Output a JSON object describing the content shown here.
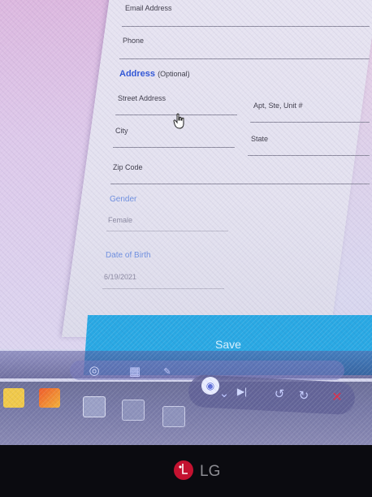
{
  "form": {
    "email_label": "Email Address",
    "phone_label": "Phone",
    "address_section": {
      "title": "Address",
      "optional_note": "(Optional)"
    },
    "street_label": "Street Address",
    "apt_label": "Apt, Ste, Unit #",
    "city_label": "City",
    "state_label": "State",
    "zip_label": "Zip Code",
    "gender_title": "Gender",
    "gender_value": "Female",
    "dob_title": "Date of Birth",
    "dob_value": "6/19/2021",
    "save_label": "Save"
  },
  "media_controls": {
    "icons": [
      "scan-icon",
      "grid-icon",
      "paint-icon",
      "camera-icon",
      "chevron-icon",
      "skip-next-icon",
      "undo-icon",
      "redo-icon",
      "close-icon"
    ]
  },
  "taskbar": {
    "icons": [
      "folder-icon",
      "pen-icon",
      "window-icon",
      "app-icon",
      "file-icon"
    ]
  },
  "monitor": {
    "brand": "LG"
  },
  "colors": {
    "accent_blue": "#2f55d6",
    "save_bar": "#29a8e3",
    "close_red": "#e0304a"
  }
}
